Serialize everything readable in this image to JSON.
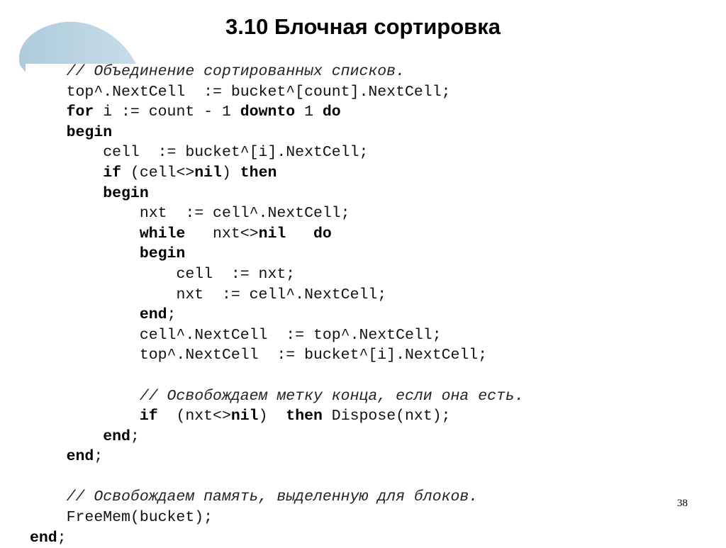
{
  "slide": {
    "title": "3.10 Блочная сортировка",
    "page_number": "38",
    "accent_color": "#b4d2e0",
    "decoration_icon": "light-blue-blob-shape"
  },
  "code": {
    "language": "Pascal",
    "lines": [
      {
        "indent": 1,
        "tokens": [
          {
            "t": "// Объединение сортированных списков.",
            "s": "comment"
          }
        ]
      },
      {
        "indent": 1,
        "tokens": [
          {
            "t": "top^.NextCell  := bucket^[count].NextCell;",
            "s": "plain"
          }
        ]
      },
      {
        "indent": 1,
        "tokens": [
          {
            "t": "for",
            "s": "kw"
          },
          {
            "t": " i := count - 1 ",
            "s": "plain"
          },
          {
            "t": "downto",
            "s": "kw"
          },
          {
            "t": " 1 ",
            "s": "plain"
          },
          {
            "t": "do",
            "s": "kw"
          }
        ]
      },
      {
        "indent": 1,
        "tokens": [
          {
            "t": "begin",
            "s": "kw"
          }
        ]
      },
      {
        "indent": 2,
        "tokens": [
          {
            "t": "cell  := bucket^[i].NextCell;",
            "s": "plain"
          }
        ]
      },
      {
        "indent": 2,
        "tokens": [
          {
            "t": "if",
            "s": "kw"
          },
          {
            "t": " (cell<>",
            "s": "plain"
          },
          {
            "t": "nil",
            "s": "kw"
          },
          {
            "t": ") ",
            "s": "plain"
          },
          {
            "t": "then",
            "s": "kw"
          }
        ]
      },
      {
        "indent": 2,
        "tokens": [
          {
            "t": "begin",
            "s": "kw"
          }
        ]
      },
      {
        "indent": 3,
        "tokens": [
          {
            "t": "nxt  := cell^.NextCell;",
            "s": "plain"
          }
        ]
      },
      {
        "indent": 3,
        "tokens": [
          {
            "t": "while",
            "s": "kw"
          },
          {
            "t": "   nxt<>",
            "s": "plain"
          },
          {
            "t": "nil",
            "s": "kw"
          },
          {
            "t": "   ",
            "s": "plain"
          },
          {
            "t": "do",
            "s": "kw"
          }
        ]
      },
      {
        "indent": 3,
        "tokens": [
          {
            "t": "begin",
            "s": "kw"
          }
        ]
      },
      {
        "indent": 4,
        "tokens": [
          {
            "t": "cell  := nxt;",
            "s": "plain"
          }
        ]
      },
      {
        "indent": 4,
        "tokens": [
          {
            "t": "nxt  := cell^.NextCell;",
            "s": "plain"
          }
        ]
      },
      {
        "indent": 3,
        "tokens": [
          {
            "t": "end",
            "s": "kw"
          },
          {
            "t": ";",
            "s": "plain"
          }
        ]
      },
      {
        "indent": 3,
        "tokens": [
          {
            "t": "cell^.NextCell  := top^.NextCell;",
            "s": "plain"
          }
        ]
      },
      {
        "indent": 3,
        "tokens": [
          {
            "t": "top^.NextCell  := bucket^[i].NextCell;",
            "s": "plain"
          }
        ]
      },
      {
        "indent": 0,
        "tokens": []
      },
      {
        "indent": 3,
        "tokens": [
          {
            "t": "// Освобождаем метку конца, если она есть.",
            "s": "comment"
          }
        ]
      },
      {
        "indent": 3,
        "tokens": [
          {
            "t": "if",
            "s": "kw"
          },
          {
            "t": "  (nxt<>",
            "s": "plain"
          },
          {
            "t": "nil",
            "s": "kw"
          },
          {
            "t": ")  ",
            "s": "plain"
          },
          {
            "t": "then",
            "s": "kw"
          },
          {
            "t": " Dispose(nxt);",
            "s": "plain"
          }
        ]
      },
      {
        "indent": 2,
        "tokens": [
          {
            "t": "end",
            "s": "kw"
          },
          {
            "t": ";",
            "s": "plain"
          }
        ]
      },
      {
        "indent": 1,
        "tokens": [
          {
            "t": "end",
            "s": "kw"
          },
          {
            "t": ";",
            "s": "plain"
          }
        ]
      },
      {
        "indent": 0,
        "tokens": []
      },
      {
        "indent": 1,
        "tokens": [
          {
            "t": "// Освобождаем память, выделенную для блоков.",
            "s": "comment"
          }
        ]
      },
      {
        "indent": 1,
        "tokens": [
          {
            "t": "FreeMem(bucket);",
            "s": "plain"
          }
        ]
      },
      {
        "indent": 0,
        "tokens": [
          {
            "t": "end",
            "s": "kw"
          },
          {
            "t": ";",
            "s": "plain"
          }
        ]
      }
    ]
  }
}
